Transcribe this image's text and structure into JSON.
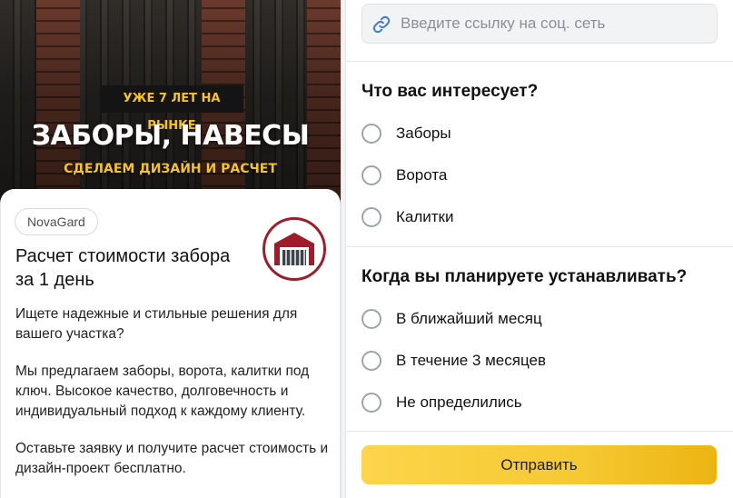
{
  "ad": {
    "banner": {
      "tag": "УЖЕ 7 ЛЕТ НА РЫНКЕ",
      "headline": "ЗАБОРЫ, НАВЕСЫ",
      "subline": "СДЕЛАЕМ ДИЗАЙН И РАСЧЕТ"
    },
    "brand": "NovaGard",
    "title": "Расчет стоимости забора за 1 день",
    "paragraphs": [
      "Ищете надежные и стильные решения для вашего участка?",
      "Мы предлагаем заборы, ворота, калитки под ключ. Высокое качество, долговечность и индивидуальный подход к каждому клиенту.",
      "Оставьте заявку и получите расчет стоимость и дизайн-проект бесплатно."
    ]
  },
  "form": {
    "social_link": {
      "placeholder": "Введите ссылку на соц. сеть",
      "value": "",
      "icon": "link-icon"
    },
    "questions": [
      {
        "title": "Что вас интересует?",
        "options": [
          "Заборы",
          "Ворота",
          "Калитки"
        ]
      },
      {
        "title": "Когда вы планируете устанавливать?",
        "options": [
          "В ближайший месяц",
          "В течение 3 месяцев",
          "Не определились"
        ]
      }
    ],
    "submit_label": "Отправить"
  },
  "colors": {
    "accent_yellow": "#f6c933",
    "banner_yellow": "#f5c424",
    "logo_red": "#9f1d2a",
    "radio_border": "#9ea3aa",
    "link_icon_blue": "#3f7ad8"
  }
}
